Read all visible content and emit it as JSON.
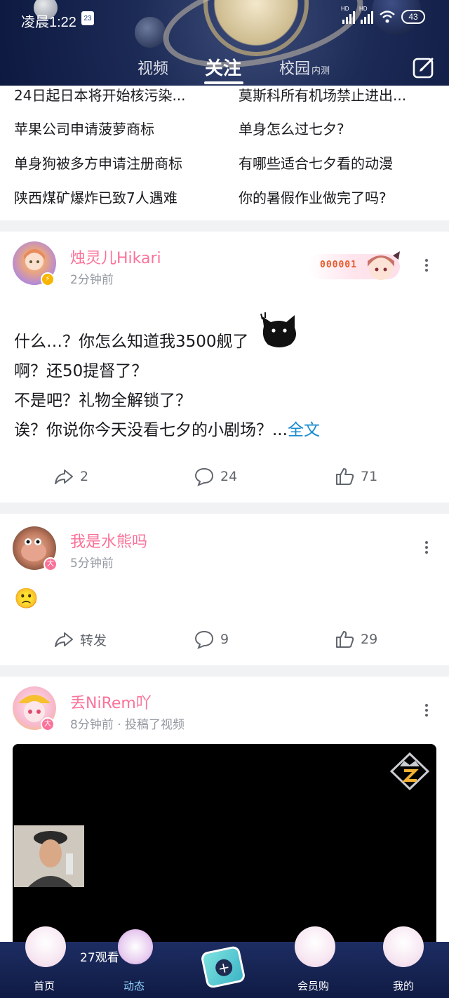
{
  "status_bar": {
    "time": "凌晨1:22",
    "calendar_day": "23",
    "signal_label": "HD",
    "battery": "43"
  },
  "tabs": {
    "video": "视频",
    "follow": "关注",
    "campus": "校园",
    "campus_tag": "内测"
  },
  "hot_topics": [
    "24日起日本将开始核污染...",
    "莫斯科所有机场禁止进出...",
    "苹果公司申请菠萝商标",
    "单身怎么过七夕?",
    "单身狗被多方申请注册商标",
    "有哪些适合七夕看的动漫",
    "陕西煤矿爆炸已致7人遇难",
    "你的暑假作业做完了吗?"
  ],
  "posts": [
    {
      "username": "烛灵儿Hikari",
      "time": "2分钟前",
      "medal_number": "000001",
      "lines": [
        "什么…？你怎么知道我3500舰了",
        "啊？还50提督了？",
        "不是吧？礼物全解锁了？",
        "诶？你说你今天没看七夕的小剧场？..."
      ],
      "full_text_link": "全文",
      "shares": "2",
      "comments": "24",
      "likes": "71"
    },
    {
      "username": "我是水熊吗",
      "time": "5分钟前",
      "badge": "大",
      "emoji": "🙁",
      "share_label": "转发",
      "comments": "9",
      "likes": "29"
    },
    {
      "username": "丢NiRem吖",
      "time": "8分钟前 · 投稿了视频",
      "badge": "大",
      "video_views": "27观看"
    }
  ],
  "bottom_nav": {
    "home": "首页",
    "dynamic": "动态",
    "vip": "会员购",
    "mine": "我的"
  },
  "colors": {
    "accent_pink": "#fb7299",
    "link_blue": "#178bcf",
    "nav_active": "#8fd3ff",
    "header_bg": "#1c2a56"
  }
}
